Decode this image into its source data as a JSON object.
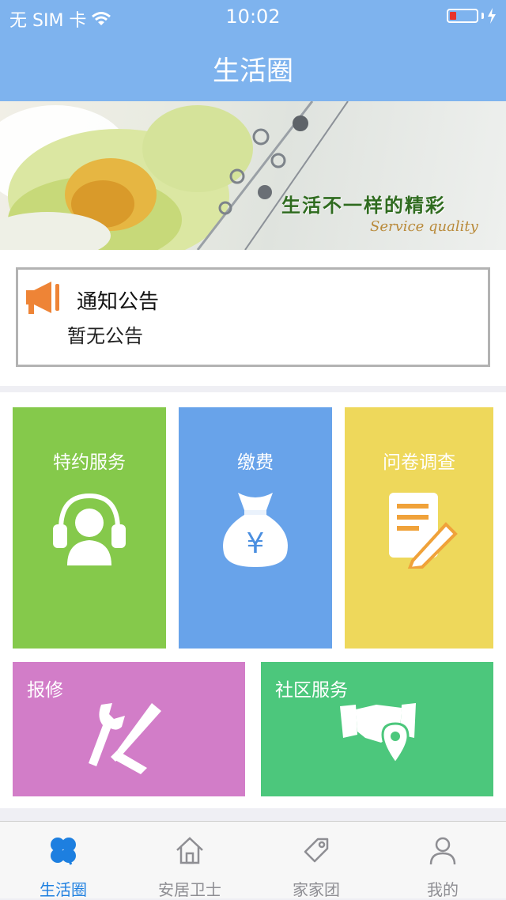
{
  "status_bar": {
    "carrier": "无 SIM 卡",
    "time": "10:02"
  },
  "header": {
    "title": "生活圈"
  },
  "banner": {
    "slogan": "生活不一样的精彩",
    "subtitle": "Service quality"
  },
  "notice": {
    "title": "通知公告",
    "empty_text": "暂无公告",
    "icon": "megaphone-icon"
  },
  "tiles": [
    {
      "label": "特约服务",
      "icon": "headset-user-icon",
      "color": "#85c94b"
    },
    {
      "label": "缴费",
      "icon": "money-bag-icon",
      "color": "#68a3ea"
    },
    {
      "label": "问卷调查",
      "icon": "survey-document-icon",
      "color": "#eed85b"
    },
    {
      "label": "报修",
      "icon": "repair-tools-icon",
      "color": "#d27dc8"
    },
    {
      "label": "社区服务",
      "icon": "handshake-location-icon",
      "color": "#4cc77c"
    }
  ],
  "tab_bar": {
    "active_color": "#1d7fe0",
    "items": [
      {
        "label": "生活圈",
        "icon": "clover-icon",
        "active": true
      },
      {
        "label": "安居卫士",
        "icon": "home-icon",
        "active": false
      },
      {
        "label": "家家团",
        "icon": "tag-icon",
        "active": false
      },
      {
        "label": "我的",
        "icon": "user-icon",
        "active": false
      }
    ]
  }
}
